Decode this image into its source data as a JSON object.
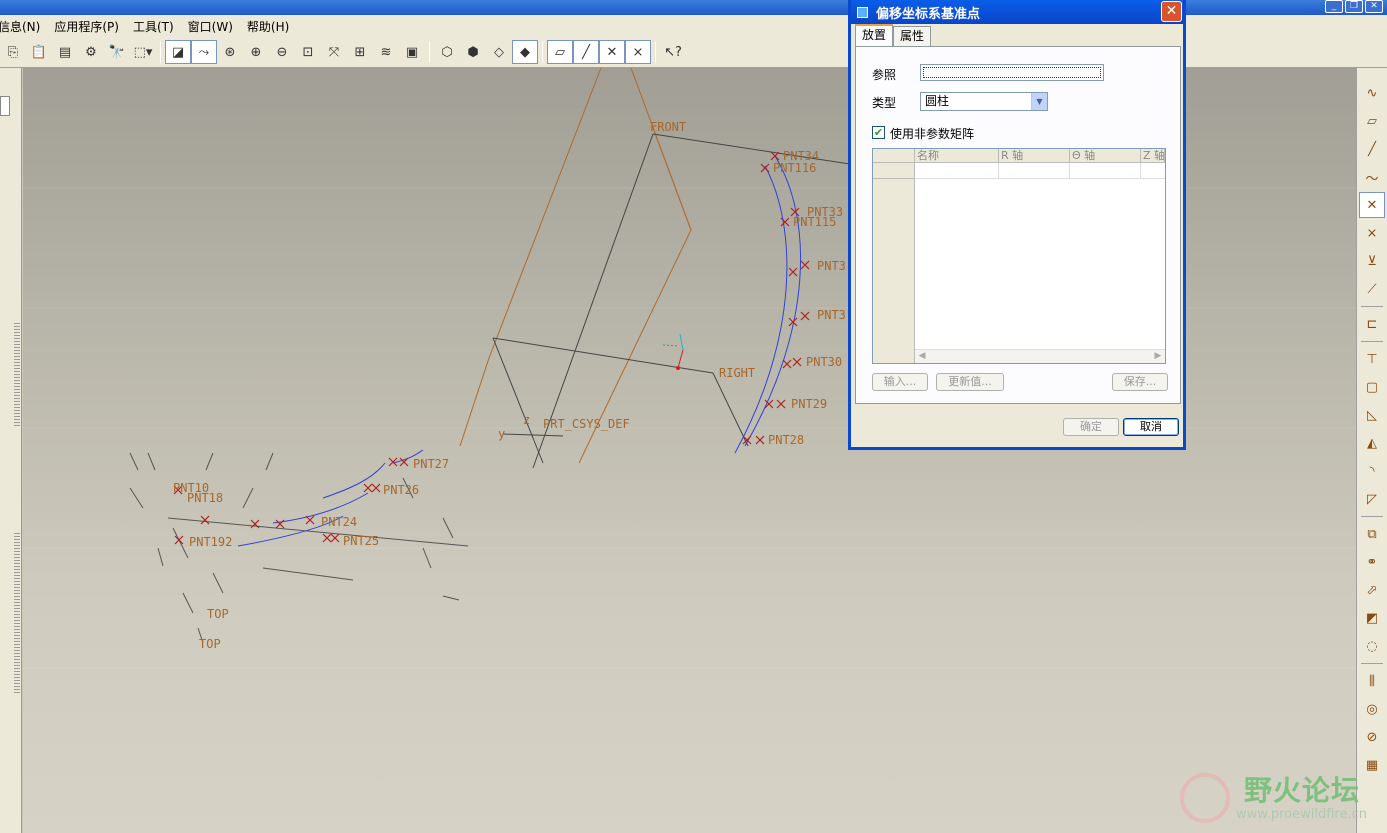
{
  "window": {
    "controls": [
      "_",
      "❐",
      "✕"
    ]
  },
  "menubar": {
    "items": [
      "信息(N)",
      "应用程序(P)",
      "工具(T)",
      "窗口(W)",
      "帮助(H)"
    ]
  },
  "viewport": {
    "labels": {
      "front": "FRONT",
      "right": "RIGHT",
      "csys": "PRT_CSYS_DEF",
      "csys_z": "z",
      "csys_y": "y",
      "top1": "TOP",
      "top2": "TOP",
      "pnt34": "PNT34",
      "pnt116": "PNT116",
      "pnt33": "PNT33",
      "pnt115": "PNT115",
      "pnt32": "PNT3",
      "pnt31": "PNT3",
      "pnt30": "PNT30",
      "pnt29": "PNT29",
      "pnt28": "PNT28",
      "pnt27": "PNT27",
      "pnt26": "PNT26",
      "pnt25": "PNT25",
      "pnt24": "PNT24",
      "pnt18": "PNT18",
      "pnt10": "PNT10",
      "pnt192": "PNT192"
    }
  },
  "dialog": {
    "title": "偏移坐标系基准点",
    "close": "✕",
    "tabs": [
      "放置",
      "属性"
    ],
    "reference_label": "参照",
    "reference_value": "",
    "type_label": "类型",
    "type_value": "圆柱",
    "use_nonparam_label": "使用非参数矩阵",
    "use_nonparam_checked": true,
    "grid_columns": [
      "名称",
      "R 轴",
      "Θ 轴",
      "Z 轴"
    ],
    "buttons": {
      "import": "输入...",
      "update": "更新值...",
      "save": "保存...",
      "ok": "确定",
      "cancel": "取消"
    }
  },
  "watermark": {
    "title": "野火论坛",
    "url": "www.proewildfire.cn"
  }
}
